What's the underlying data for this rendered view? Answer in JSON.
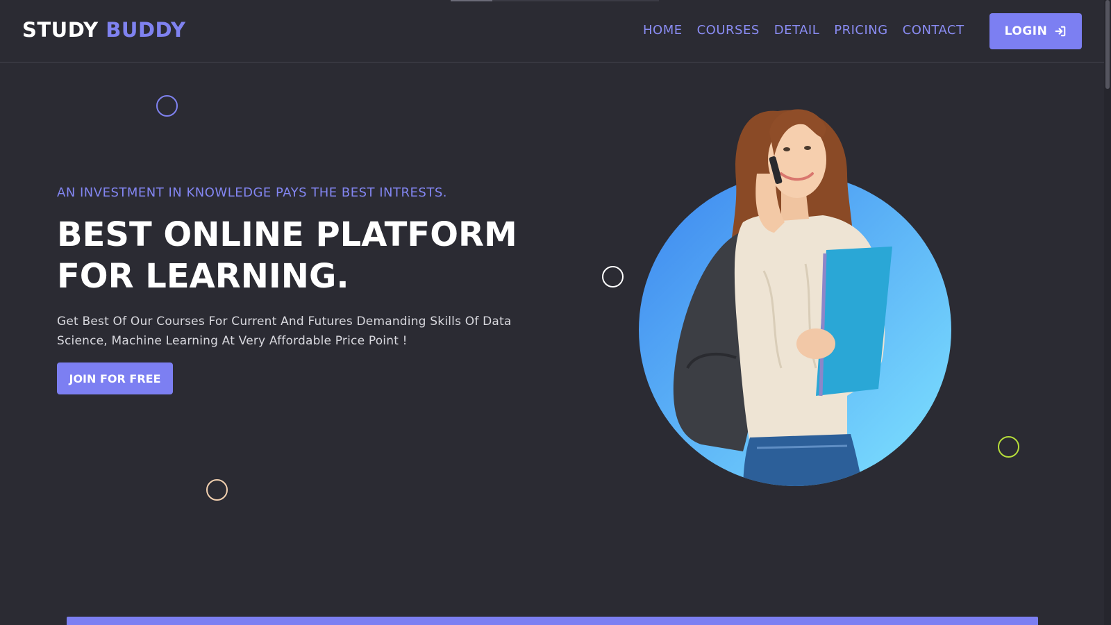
{
  "header": {
    "logo": {
      "primary": "STUDY",
      "accent": "BUDDY"
    },
    "nav": [
      {
        "label": "HOME"
      },
      {
        "label": "COURSES"
      },
      {
        "label": "DETAIL"
      },
      {
        "label": "PRICING"
      },
      {
        "label": "CONTACT"
      }
    ],
    "login": {
      "label": "LOGIN",
      "icon": "sign-in-icon"
    }
  },
  "hero": {
    "tagline": "AN INVESTMENT IN KNOWLEDGE PAYS THE BEST INTRESTS.",
    "headline": [
      "BEST ONLINE PLATFORM",
      "FOR LEARNING."
    ],
    "description": "Get Best Of Our Courses For Current And Futures Demanding Skills Of Data Science, Machine Learning At Very Affordable Price Point !",
    "cta_label": "JOIN FOR FREE",
    "image": "student-with-phone-and-books"
  },
  "theme": {
    "background": "#2b2b33",
    "accent": "#7c7ff2",
    "text": "#ffffff",
    "ring_colors": [
      "#7f82f0",
      "#ffffff",
      "#f3d1b0",
      "#b6dd3a"
    ]
  }
}
